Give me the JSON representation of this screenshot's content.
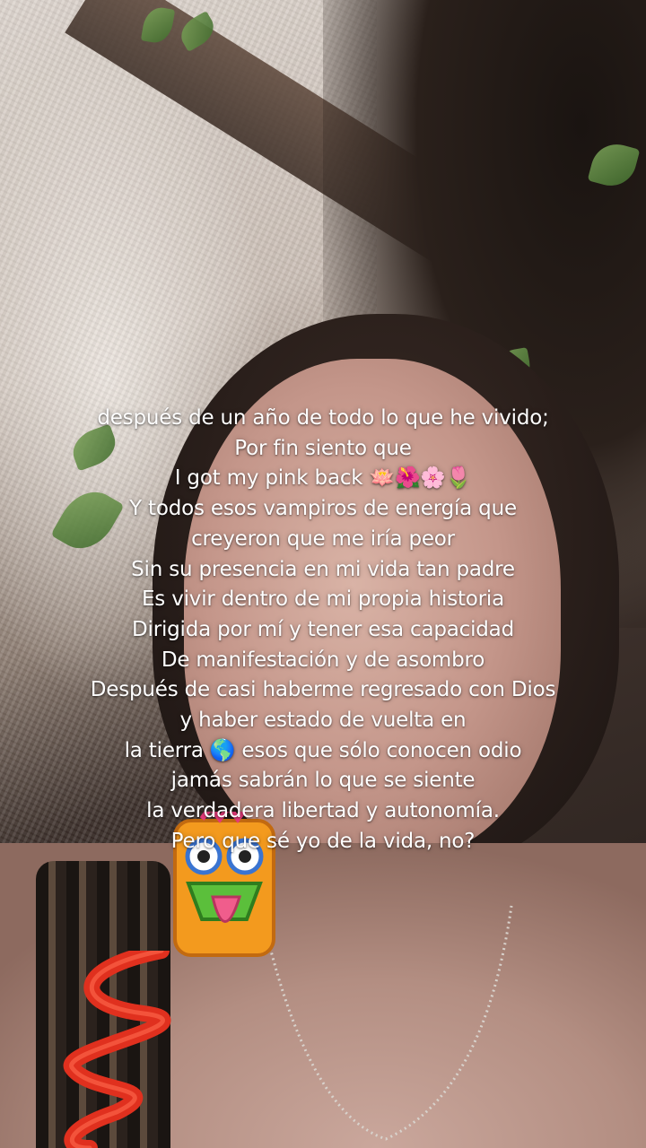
{
  "caption": {
    "lines": [
      "después de un año de todo lo que he vivido;",
      "Por fin  siento que",
      "I got my pink back 🪷🌺🌸🌷",
      "Y todos esos vampiros de energía que",
      "creyeron que me iría peor",
      "Sin su presencia en mi vida tan padre",
      "Es vivir dentro de mi propia historia",
      "Dirigida por mí y tener esa capacidad",
      "De manifestación y de asombro",
      "Después de casi haberme regresado con Dios",
      "y haber estado de vuelta en",
      "la tierra 🌎 esos que sólo conocen odio",
      "jamás sabrán lo que se siente",
      "la verdadera libertad y autonomía.",
      "Pero que sé yo de la vida, no?"
    ]
  },
  "colors": {
    "caption_text": "#ffffff",
    "wall": "#cbbfb6",
    "leaf": "#5f8a3f",
    "straw": "#e0301e"
  },
  "icons": {
    "lotus": "lotus-emoji",
    "hibiscus": "hibiscus-emoji",
    "blossom": "cherry-blossom-emoji",
    "tulip": "tulip-emoji",
    "globe": "globe-americas-emoji"
  }
}
